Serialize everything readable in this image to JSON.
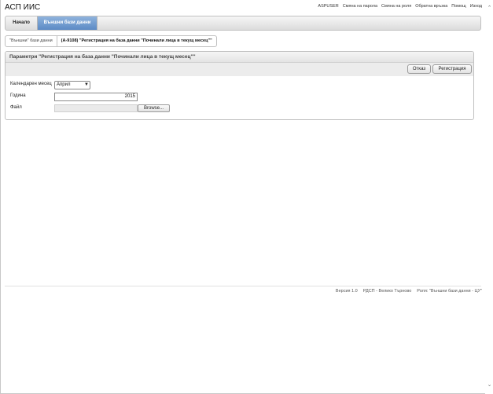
{
  "app": {
    "title": "АСП ИИС"
  },
  "top_links": [
    "ASPUSER",
    "Смяна на парола",
    "Смяна на роля",
    "Обратна връзка",
    "Помощ",
    "Изход"
  ],
  "nav": {
    "home": "Начало",
    "external": "Външни бази данни"
  },
  "breadcrumb": {
    "parent": "\"Външни\" бази данни",
    "current": "(А-9108) \"Регистрация на база данни \"Починали лица в текущ месец\"\""
  },
  "panel": {
    "title": "Параметри \"Регистрация на база данни \"Починали лица в текущ месец\"\"",
    "cancel_label": "Отказ",
    "register_label": "Регистрация"
  },
  "form": {
    "month_label": "Календарен месец",
    "month_value": "Април",
    "year_label": "Година",
    "year_value": "2015",
    "file_label": "Файл",
    "browse_label": "Browse..."
  },
  "footer": {
    "version": "Версия 1.0",
    "org": "РДСП - Велико Търново",
    "role": "Роля: \"Външни бази данни - ЦУ\""
  },
  "colors": {
    "nav_active": "#5b8ac5",
    "panel_header": "#e4e4e4",
    "toolbar": "#ececec"
  }
}
